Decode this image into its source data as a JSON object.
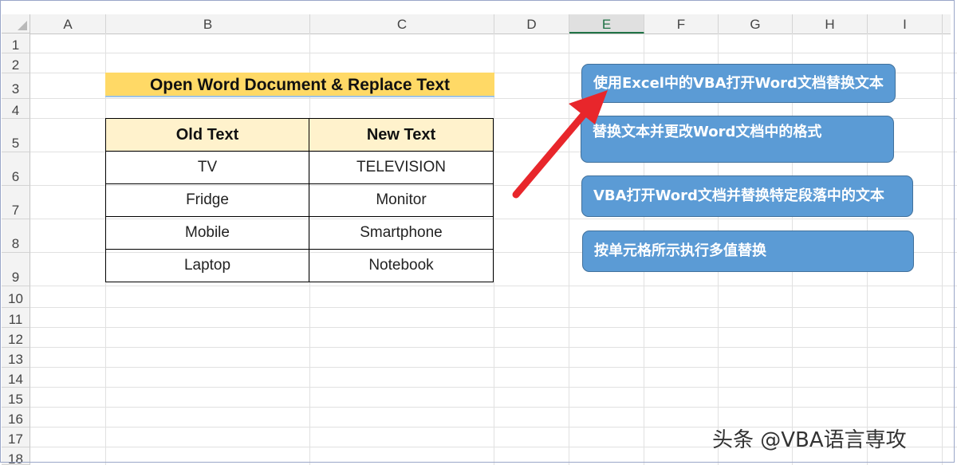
{
  "columns": [
    "A",
    "B",
    "C",
    "D",
    "E",
    "F",
    "G",
    "H",
    "I"
  ],
  "rows": [
    "1",
    "2",
    "3",
    "4",
    "5",
    "6",
    "7",
    "8",
    "9",
    "10",
    "11",
    "12",
    "13",
    "14",
    "15",
    "16",
    "17",
    "18"
  ],
  "title": "Open Word Document & Replace Text",
  "table": {
    "headers": [
      "Old Text",
      "New Text"
    ],
    "rows": [
      [
        "TV",
        "TELEVISION"
      ],
      [
        "Fridge",
        "Monitor"
      ],
      [
        "Mobile",
        "Smartphone"
      ],
      [
        "Laptop",
        "Notebook"
      ]
    ]
  },
  "shapes": [
    "使用Excel中的VBA打开Word文档替换文本",
    "替换文本并更改Word文档中的格式",
    "VBA打开Word文档并替换特定段落中的文本",
    "按单元格所示执行多值替换"
  ],
  "watermark": "头条 @VBA语言専攻",
  "colors": {
    "shape_fill": "#5b9bd5",
    "title_fill": "#ffd966",
    "header_fill": "#fff2cc",
    "arrow": "#e8262b"
  }
}
